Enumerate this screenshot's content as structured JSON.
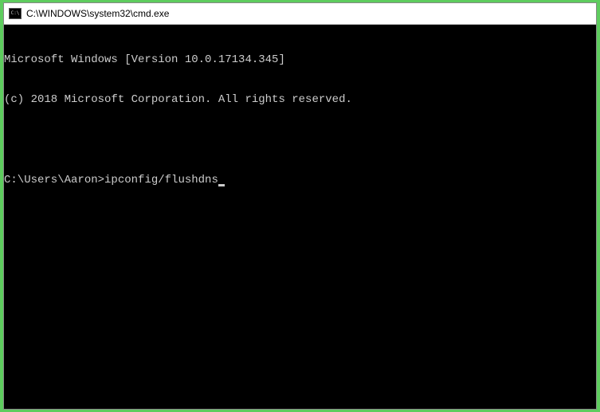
{
  "window": {
    "title": "C:\\WINDOWS\\system32\\cmd.exe"
  },
  "terminal": {
    "lines": [
      "Microsoft Windows [Version 10.0.17134.345]",
      "(c) 2018 Microsoft Corporation. All rights reserved.",
      ""
    ],
    "prompt": "C:\\Users\\Aaron>",
    "command": "ipconfig/flushdns"
  }
}
